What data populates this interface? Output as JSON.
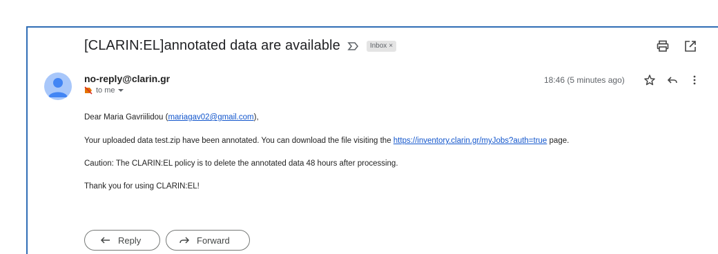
{
  "message": {
    "subject": "[CLARIN:EL]annotated data are available",
    "label_chip": "Inbox",
    "label_chip_remove": "×",
    "sender": "no-reply@clarin.gr",
    "recipient_label": "to me",
    "timestamp": "18:46 (5 minutes ago)"
  },
  "body": {
    "greeting_prefix": "Dear Maria Gavriilidou (",
    "greeting_email": "mariagav02@gmail.com",
    "greeting_suffix": "),",
    "line2_prefix": "Your uploaded data test.zip have been annotated. You can download the file visiting the ",
    "line2_link": "https://inventory.clarin.gr/myJobs?auth=true",
    "line2_suffix": " page.",
    "line3": "Caution: The CLARIN:EL policy is to delete the annotated data 48 hours after processing.",
    "line4": "Thank you for using CLARIN:EL!"
  },
  "actions": {
    "reply_label": "Reply",
    "forward_label": "Forward"
  },
  "icons": [
    "importance-marker-icon",
    "print-icon",
    "open-in-new-window-icon",
    "avatar-person-icon",
    "not-important-tag-icon",
    "star-icon",
    "reply-icon",
    "more-vert-icon",
    "forward-icon"
  ],
  "colors": {
    "accent_border": "#2f6db5",
    "link": "#1155cc",
    "avatar_bg": "#a8c7fa",
    "avatar_fg": "#4285f4"
  }
}
